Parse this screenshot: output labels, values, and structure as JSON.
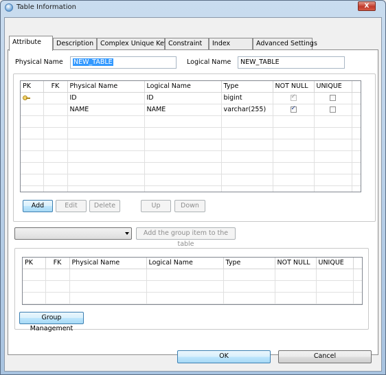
{
  "window": {
    "title": "Table Information",
    "close_glyph": "X"
  },
  "tabs": [
    {
      "label": "Attribute",
      "active": true
    },
    {
      "label": "Description"
    },
    {
      "label": "Complex Unique Key"
    },
    {
      "label": "Constraint"
    },
    {
      "label": "Index"
    },
    {
      "label": "Advanced Settings"
    }
  ],
  "form": {
    "physical_name_label": "Physical Name",
    "physical_name_value": "NEW_TABLE",
    "logical_name_label": "Logical Name",
    "logical_name_value": "NEW_TABLE"
  },
  "columns_table": {
    "headers": [
      "PK",
      "FK",
      "Physical Name",
      "Logical Name",
      "Type",
      "NOT NULL",
      "UNIQUE"
    ],
    "rows": [
      {
        "pk": true,
        "fk": "",
        "physical": "ID",
        "logical": "ID",
        "type": "bigint",
        "not_null": true,
        "not_null_disabled": true,
        "unique": false
      },
      {
        "pk": false,
        "fk": "",
        "physical": "NAME",
        "logical": "NAME",
        "type": "varchar(255)",
        "not_null": true,
        "not_null_disabled": false,
        "unique": false
      }
    ]
  },
  "row_buttons": {
    "add": "Add",
    "edit": "Edit",
    "delete": "Delete",
    "up": "Up",
    "down": "Down"
  },
  "group": {
    "dropdown_value": "",
    "add_group_button": "Add the group item to the table",
    "headers": [
      "PK",
      "FK",
      "Physical Name",
      "Logical Name",
      "Type",
      "NOT NULL",
      "UNIQUE"
    ],
    "manage_button": "Group Management"
  },
  "footer": {
    "ok": "OK",
    "cancel": "Cancel"
  },
  "icons": {
    "primary_key": "key-icon"
  }
}
